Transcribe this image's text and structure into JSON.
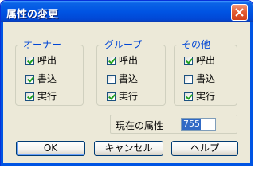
{
  "window": {
    "title": "属性の変更"
  },
  "groups": [
    {
      "label": "オーナー",
      "items": [
        {
          "label": "呼出",
          "checked": true
        },
        {
          "label": "書込",
          "checked": true
        },
        {
          "label": "実行",
          "checked": true
        }
      ]
    },
    {
      "label": "グループ",
      "items": [
        {
          "label": "呼出",
          "checked": true
        },
        {
          "label": "書込",
          "checked": false
        },
        {
          "label": "実行",
          "checked": true
        }
      ]
    },
    {
      "label": "その他",
      "items": [
        {
          "label": "呼出",
          "checked": true
        },
        {
          "label": "書込",
          "checked": false
        },
        {
          "label": "実行",
          "checked": true
        }
      ]
    }
  ],
  "current_attr": {
    "label": "現在の属性",
    "value": "755"
  },
  "buttons": {
    "ok": "OK",
    "cancel": "キャンセル",
    "help": "ヘルプ"
  },
  "colors": {
    "titlebar": "#0054e3",
    "group_label": "#0046d5",
    "dialog_bg": "#ece9d8",
    "check": "#21a121",
    "close_button": "#e35d34"
  }
}
